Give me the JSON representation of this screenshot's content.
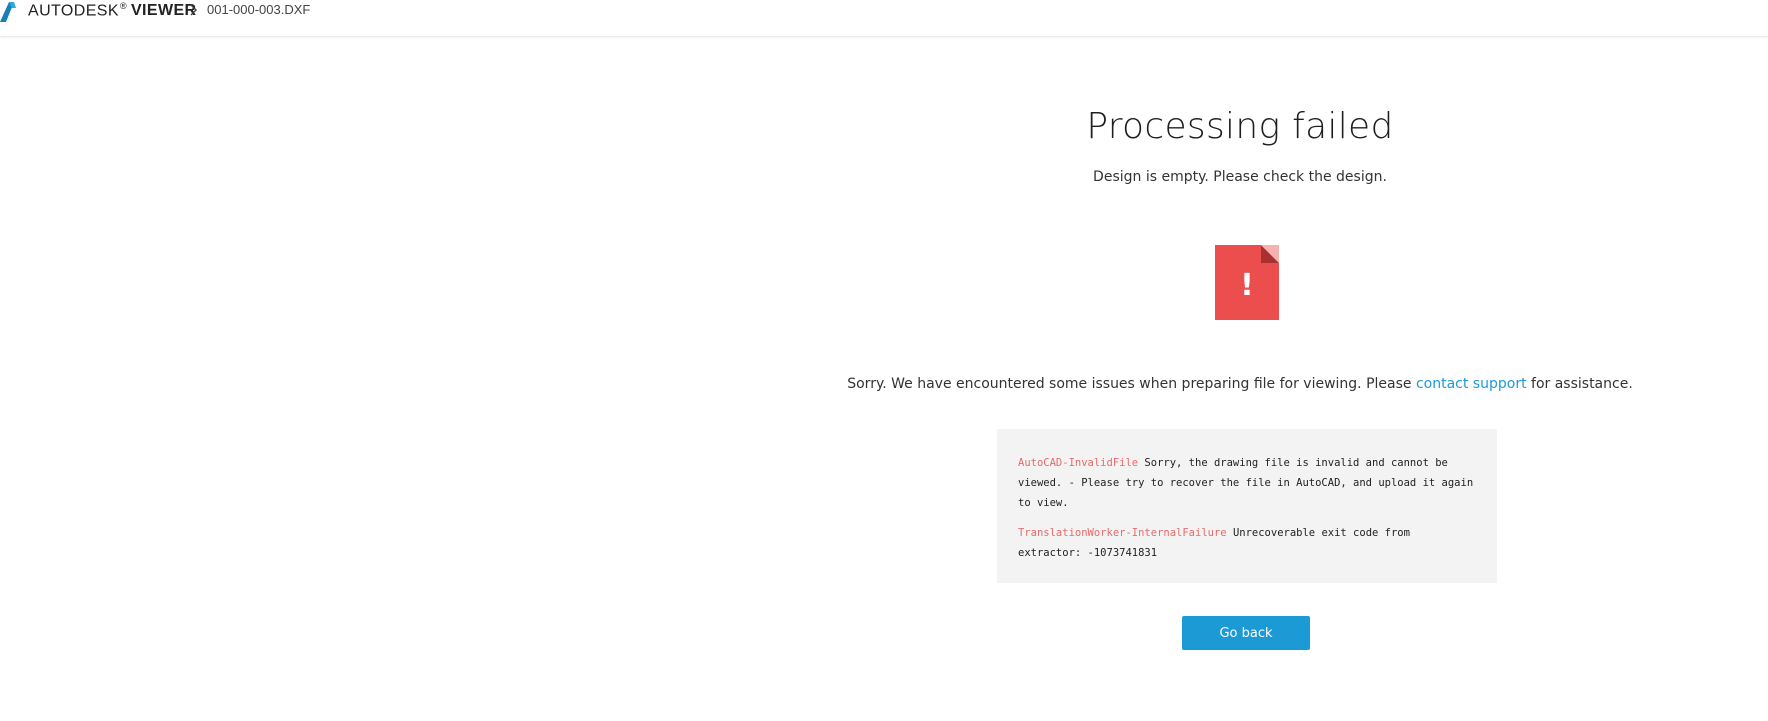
{
  "header": {
    "brand_primary": "AUTODESK",
    "brand_trademark": "®",
    "brand_secondary": "VIEWER",
    "breadcrumb_file": "001-000-003.DXF",
    "logo_icon": "autodesk-a-logo",
    "separator_icon": "chevron-right-icon"
  },
  "main": {
    "title": "Processing failed",
    "subtitle": "Design is empty. Please check the design.",
    "error_icon": "file-error-icon",
    "error_icon_symbol": "!",
    "sorry_before": "Sorry. We have encountered some issues when preparing file for viewing. Please ",
    "sorry_link": "contact support",
    "sorry_after": " for assistance.",
    "errors": [
      {
        "code": "AutoCAD-InvalidFile",
        "message": " Sorry, the drawing file is invalid and cannot be viewed. - Please try to recover the file in AutoCAD, and upload it again to view."
      },
      {
        "code": "TranslationWorker-InternalFailure",
        "message": " Unrecoverable exit code from extractor: -1073741831"
      }
    ],
    "go_back_label": "Go back"
  },
  "colors": {
    "accent": "#1c9ad6",
    "error_red": "#e84c4c",
    "error_code": "#e86a6a",
    "panel_bg": "#f3f3f3"
  }
}
